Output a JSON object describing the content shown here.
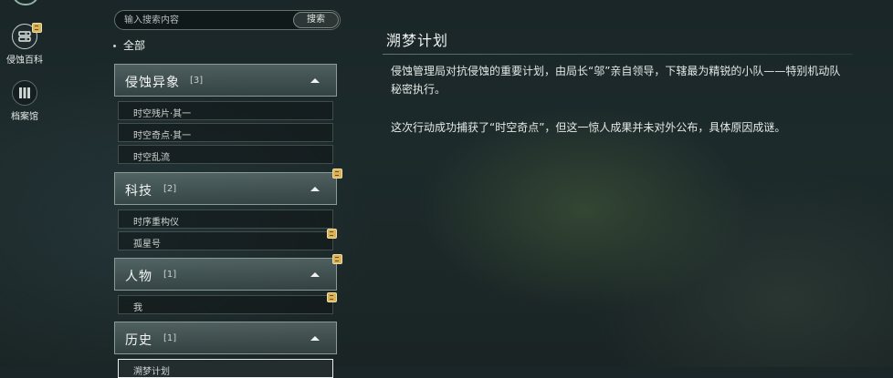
{
  "sidebar": {
    "items": [
      {
        "label": "侵蚀百科",
        "icon": "encyclopedia-icon",
        "active": true,
        "has_new": true
      },
      {
        "label": "档案馆",
        "icon": "archive-icon",
        "active": false,
        "has_new": false
      }
    ]
  },
  "search": {
    "placeholder": "输入搜索内容",
    "value": "",
    "button_label": "搜索"
  },
  "filter": {
    "label": "全部"
  },
  "categories": [
    {
      "name": "侵蚀异象",
      "count": "[3]",
      "expanded": true,
      "has_new": false,
      "entries": [
        {
          "label": "时空残片·其一",
          "has_new": false
        },
        {
          "label": "时空奇点·其一",
          "has_new": false
        },
        {
          "label": "时空乱流",
          "has_new": false
        }
      ]
    },
    {
      "name": "科技",
      "count": "[2]",
      "expanded": true,
      "has_new": true,
      "entries": [
        {
          "label": "时序重构仪",
          "has_new": false
        },
        {
          "label": "孤星号",
          "has_new": true
        }
      ]
    },
    {
      "name": "人物",
      "count": "[1]",
      "expanded": true,
      "has_new": true,
      "entries": [
        {
          "label": "我",
          "has_new": true
        }
      ]
    },
    {
      "name": "历史",
      "count": "[1]",
      "expanded": true,
      "has_new": false,
      "entries": [
        {
          "label": "溯梦计划",
          "has_new": false,
          "selected": true
        }
      ]
    }
  ],
  "detail": {
    "title": "溯梦计划",
    "paragraphs": [
      "侵蚀管理局对抗侵蚀的重要计划，由局长“邬”亲自领导，下辖最为精锐的小队——特别机动队秘密执行。",
      "这次行动成功捕获了“时空奇点”，但这一惊人成果并未对外公布，具体原因成谜。"
    ]
  },
  "colors": {
    "badge": "#d8b35a",
    "category_header": "#6e8281",
    "background": "#1b2727"
  }
}
